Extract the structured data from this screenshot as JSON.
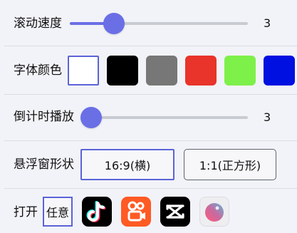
{
  "scroll_speed": {
    "label": "滚动速度",
    "value": "3",
    "level": 0.23
  },
  "font_color": {
    "label": "字体颜色",
    "swatches": [
      "#ffffff",
      "#000000",
      "#777777",
      "#e8342a",
      "#7ef04a",
      "#0010e0"
    ],
    "selected_index": 0,
    "accent_color": "#5b63d6"
  },
  "countdown": {
    "label": "倒计时播放",
    "value": "3",
    "level": 0.0
  },
  "float_window_shape": {
    "label": "悬浮窗形状",
    "options": [
      "16:9(横)",
      "1:1(正方形)"
    ],
    "selected_index": 0
  },
  "open_with": {
    "label": "打开",
    "any_label": "任意",
    "apps": [
      "tiktok-icon",
      "kuaishou-icon",
      "capcut-icon",
      "camera-lens-icon"
    ]
  }
}
